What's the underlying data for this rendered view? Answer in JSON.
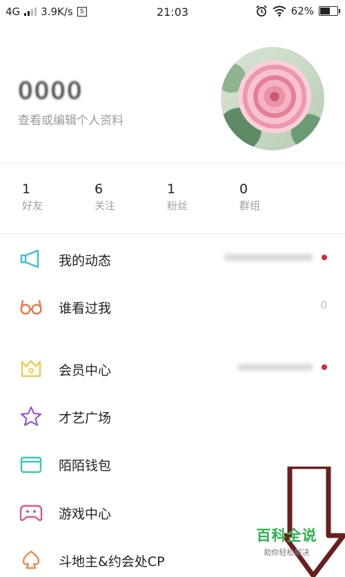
{
  "status_bar": {
    "network": "4G",
    "speed": "3.9K/s",
    "sim_icon": "S",
    "time": "21:03",
    "battery": "62%",
    "battery_level": 0.62
  },
  "profile": {
    "username": "0000",
    "edit_link": "查看或编辑个人资料"
  },
  "stats": [
    {
      "count": "1",
      "label": "好友"
    },
    {
      "count": "6",
      "label": "关注"
    },
    {
      "count": "1",
      "label": "粉丝"
    },
    {
      "count": "0",
      "label": "群组"
    }
  ],
  "menu": [
    {
      "label": "我的动态",
      "icon": "megaphone-icon",
      "color": "#3cc0d0"
    },
    {
      "label": "谁看过我",
      "icon": "glasses-icon",
      "color": "#e8754c",
      "count": "0"
    },
    {
      "label": "会员中心",
      "icon": "crown-icon",
      "color": "#f2c94c"
    },
    {
      "label": "才艺广场",
      "icon": "star-icon",
      "color": "#9b55d8"
    },
    {
      "label": "陌陌钱包",
      "icon": "wallet-icon",
      "color": "#3cc8b4"
    },
    {
      "label": "游戏中心",
      "icon": "gamepad-icon",
      "color": "#e8508a"
    },
    {
      "label": "斗地主&约会处CP",
      "icon": "spade-icon",
      "color": "#f08a4c"
    }
  ],
  "watermark": {
    "title": "百科全说",
    "subtitle": "助你轻松解决"
  },
  "colors": {
    "notification_dot": "#e0233a",
    "annotation_arrow": "#6b1e1e",
    "watermark_green": "#2bb24c"
  }
}
